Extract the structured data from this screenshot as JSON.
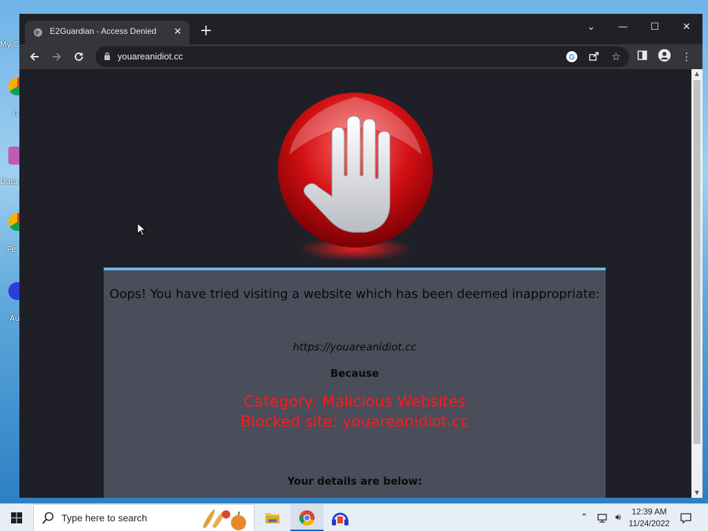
{
  "desktop": {
    "icons": [
      {
        "label": "My C",
        "icon": "computer-icon"
      },
      {
        "label": "G",
        "icon": "chrome-icon"
      },
      {
        "label": "Data",
        "icon": "app-icon"
      },
      {
        "label": "Pe",
        "icon": "chrome-icon"
      },
      {
        "label": "Au",
        "icon": "audio-icon"
      }
    ]
  },
  "browser": {
    "tab": {
      "title": "E2Guardian - Access Denied",
      "close": "✕"
    },
    "new_tab": "+",
    "window_controls": {
      "tab_search": "⌄",
      "minimize": "—",
      "maximize": "☐",
      "close": "✕"
    },
    "address": {
      "url": "youareanidiot.cc"
    }
  },
  "page": {
    "message": "Oops! You have tried visiting a website which has been deemed inappropriate:",
    "blocked_url": "https://youareanidiot.cc",
    "because": "Because",
    "category": "Category: Malicious Websites",
    "blocked_site": "Blocked site: youareanidiot.cc",
    "details": "Your details are below:"
  },
  "taskbar": {
    "search_placeholder": "Type here to search",
    "clock": {
      "time": "12:39 AM",
      "date": "11/24/2022"
    }
  },
  "colors": {
    "accent_blue": "#6fb6ea",
    "reason_red": "#ff1a1a",
    "panel_bg": "#4a4d5a",
    "page_bg": "#1f2027"
  }
}
